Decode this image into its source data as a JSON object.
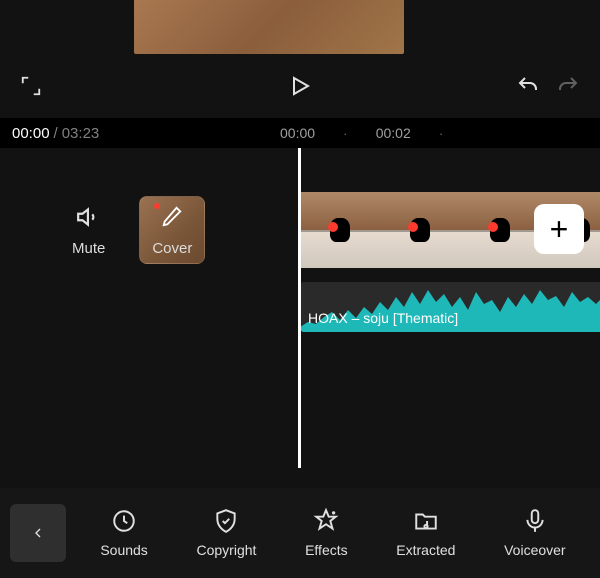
{
  "player": {
    "current_time": "00:00",
    "duration": "03:23"
  },
  "ruler": {
    "ticks": [
      "00:00",
      "00:02"
    ]
  },
  "timeline_tools": {
    "mute_label": "Mute",
    "cover_label": "Cover"
  },
  "audio": {
    "track_label": "HOAX – soju [Thematic]"
  },
  "add_clip_glyph": "+",
  "bottom": {
    "sounds": "Sounds",
    "copyright": "Copyright",
    "effects": "Effects",
    "extracted": "Extracted",
    "voiceover": "Voiceover"
  }
}
